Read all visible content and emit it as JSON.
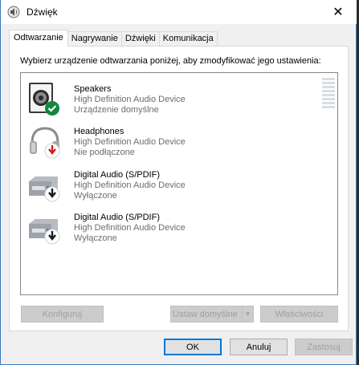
{
  "window": {
    "title": "Dźwięk",
    "close_glyph": "✕"
  },
  "tabs": [
    {
      "label": "Odtwarzanie",
      "active": true
    },
    {
      "label": "Nagrywanie",
      "active": false
    },
    {
      "label": "Dźwięki",
      "active": false
    },
    {
      "label": "Komunikacja",
      "active": false
    }
  ],
  "panel": {
    "instruction": "Wybierz urządzenie odtwarzania poniżej, aby zmodyfikować jego ustawienia:"
  },
  "devices": [
    {
      "name": "Speakers",
      "driver": "High Definition Audio Device",
      "status": "Urządzenie domyślne",
      "icon": "speaker-icon",
      "badge": "default-check",
      "badge_color": "#10893e"
    },
    {
      "name": "Headphones",
      "driver": "High Definition Audio Device",
      "status": "Nie podłączone",
      "icon": "headphones-icon",
      "badge": "unplugged-arrow",
      "badge_color": "#d21e1e"
    },
    {
      "name": "Digital Audio (S/PDIF)",
      "driver": "High Definition Audio Device",
      "status": "Wyłączone",
      "icon": "digital-audio-icon",
      "badge": "disabled-arrow",
      "badge_color": "#1a1a1a"
    },
    {
      "name": "Digital Audio (S/PDIF)",
      "driver": "High Definition Audio Device",
      "status": "Wyłączone",
      "icon": "digital-audio-icon",
      "badge": "disabled-arrow",
      "badge_color": "#1a1a1a"
    }
  ],
  "buttons": {
    "configure": "Konfiguruj",
    "set_default": "Ustaw domyślne",
    "properties": "Właściwości",
    "ok": "OK",
    "cancel": "Anuluj",
    "apply": "Zastosuj"
  },
  "colors": {
    "accent": "#0078d7",
    "window_border": "#3c7dbf"
  }
}
